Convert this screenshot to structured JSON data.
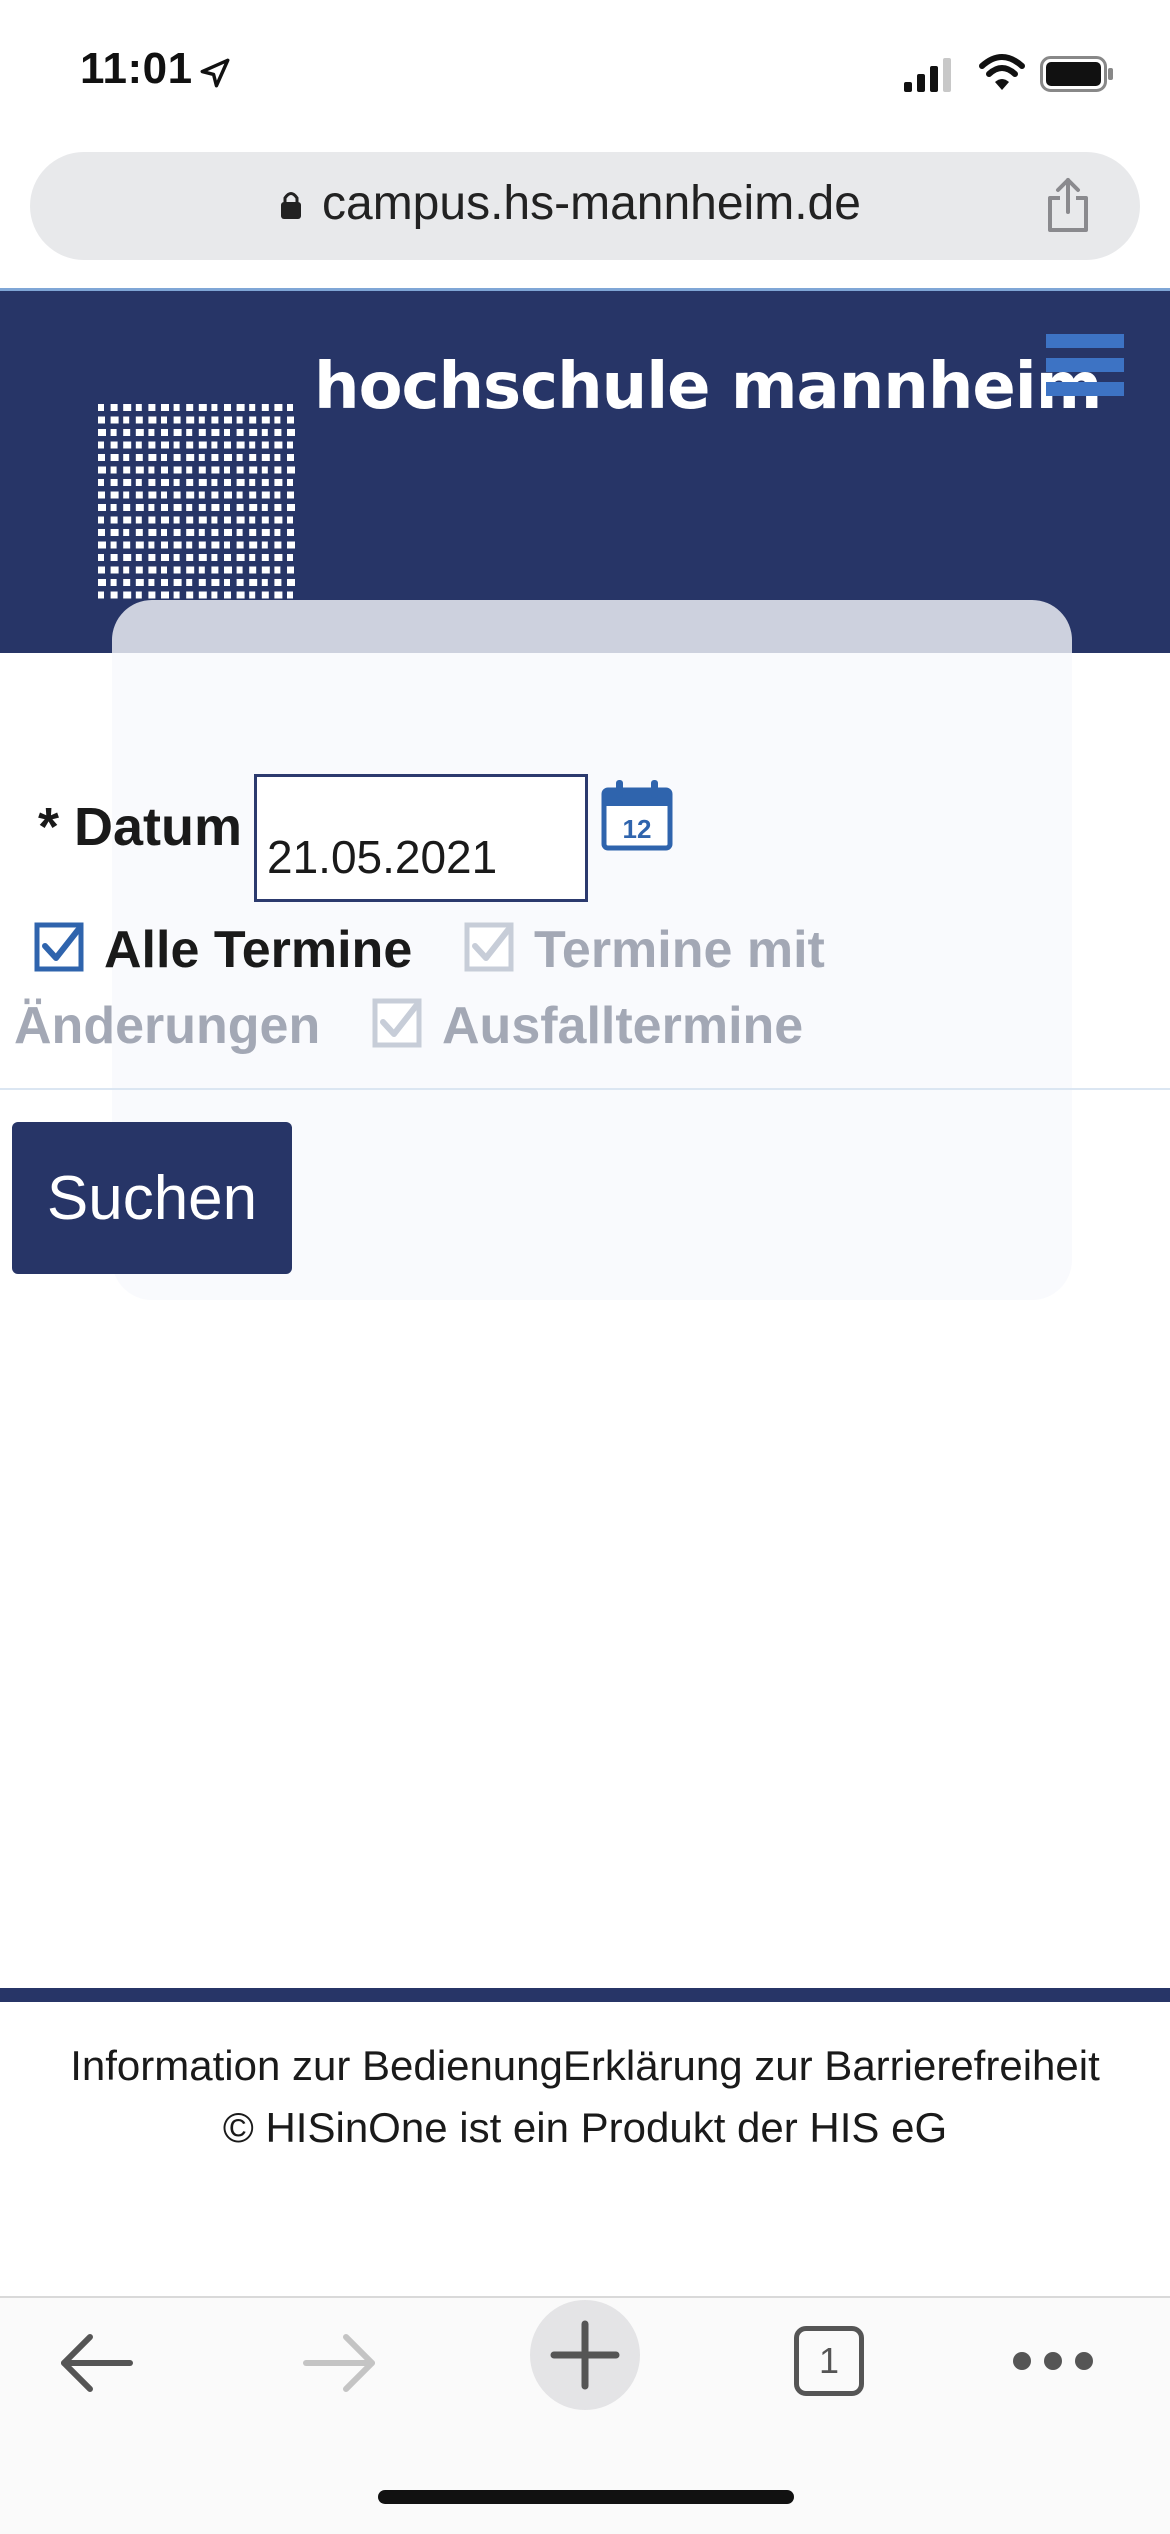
{
  "status_bar": {
    "time": "11:01",
    "icons": [
      "location-arrow-icon",
      "signal-icon",
      "wifi-icon",
      "battery-icon"
    ]
  },
  "browser": {
    "url": "campus.hs-mannheim.de",
    "icons": [
      "lock-icon",
      "share-icon"
    ]
  },
  "header": {
    "logo_text": "hochschule mannheim",
    "background_color": "#273567",
    "icons": [
      "logo-grid-icon",
      "hamburger-menu-icon"
    ]
  },
  "form": {
    "date_label": "* Datum",
    "date_value": "21.05.2021",
    "calendar_day": "12",
    "checkboxes": [
      {
        "label": "Alle Termine",
        "checked": true,
        "enabled": true
      },
      {
        "label": "Termine mit Änderungen",
        "label_part1": "Termine mit",
        "label_part2": "Änderungen",
        "checked": true,
        "enabled": false
      },
      {
        "label": "Ausfalltermine",
        "checked": true,
        "enabled": false
      }
    ],
    "search_label": "Suchen"
  },
  "footer": {
    "line1": "Information zur BedienungErklärung zur Barrierefreiheit",
    "line2": "© HISinOne ist ein Produkt der HIS eG"
  },
  "toolbar": {
    "tab_count": "1",
    "icons": [
      "back-arrow-icon",
      "forward-arrow-icon",
      "new-tab-icon",
      "tabs-icon",
      "more-icon"
    ]
  }
}
